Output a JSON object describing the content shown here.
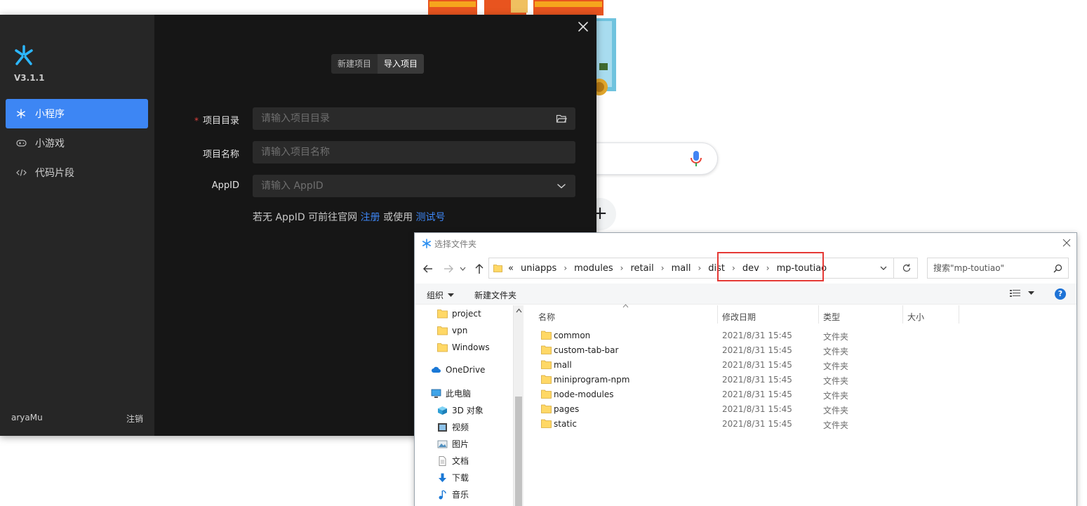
{
  "ide": {
    "version": "V3.1.1",
    "nav": [
      {
        "label": "小程序",
        "icon": "asterisk-icon"
      },
      {
        "label": "小游戏",
        "icon": "gamepad-icon"
      },
      {
        "label": "代码片段",
        "icon": "code-icon"
      }
    ],
    "user": "aryaMu",
    "logout": "注销",
    "tabs": [
      "新建项目",
      "导入项目"
    ],
    "active_tab": "导入项目",
    "form": {
      "dir_label": "项目目录",
      "dir_required_mark": "*",
      "dir_placeholder": "请输入项目目录",
      "name_label": "项目名称",
      "name_placeholder": "请输入项目名称",
      "appid_label": "AppID",
      "appid_placeholder": "请输入 AppID",
      "hint_prefix": "若无 AppID 可前往官网",
      "hint_link1": "注册",
      "hint_mid": "或使用",
      "hint_link2": "测试号"
    },
    "accent_color": "#3d86f4"
  },
  "browser": {
    "shortcut_add": "+"
  },
  "picker": {
    "title": "选择文件夹",
    "breadcrumb_overflow": "«",
    "breadcrumb": [
      "uniapps",
      "modules",
      "retail",
      "mall",
      "dist",
      "dev",
      "mp-toutiao"
    ],
    "search_placeholder": "搜索\"mp-toutiao\"",
    "toolbar": {
      "organize": "组织",
      "new_folder": "新建文件夹",
      "help": "?"
    },
    "tree": [
      {
        "label": "project",
        "icon": "folder-icon"
      },
      {
        "label": "vpn",
        "icon": "folder-icon"
      },
      {
        "label": "Windows",
        "icon": "folder-icon"
      },
      {
        "label": "OneDrive",
        "icon": "cloud-icon"
      },
      {
        "label": "此电脑",
        "icon": "computer-icon"
      },
      {
        "label": "3D 对象",
        "icon": "cube-icon"
      },
      {
        "label": "视频",
        "icon": "video-icon"
      },
      {
        "label": "图片",
        "icon": "picture-icon"
      },
      {
        "label": "文档",
        "icon": "document-icon"
      },
      {
        "label": "下载",
        "icon": "download-icon"
      },
      {
        "label": "音乐",
        "icon": "music-icon"
      }
    ],
    "columns": [
      "名称",
      "修改日期",
      "类型",
      "大小"
    ],
    "files": [
      {
        "name": "common",
        "date": "2021/8/31 15:45",
        "type": "文件夹"
      },
      {
        "name": "custom-tab-bar",
        "date": "2021/8/31 15:45",
        "type": "文件夹"
      },
      {
        "name": "mall",
        "date": "2021/8/31 15:45",
        "type": "文件夹"
      },
      {
        "name": "miniprogram-npm",
        "date": "2021/8/31 15:45",
        "type": "文件夹"
      },
      {
        "name": "node-modules",
        "date": "2021/8/31 15:45",
        "type": "文件夹"
      },
      {
        "name": "pages",
        "date": "2021/8/31 15:45",
        "type": "文件夹"
      },
      {
        "name": "static",
        "date": "2021/8/31 15:45",
        "type": "文件夹"
      }
    ],
    "highlight_color": "#e53935"
  }
}
